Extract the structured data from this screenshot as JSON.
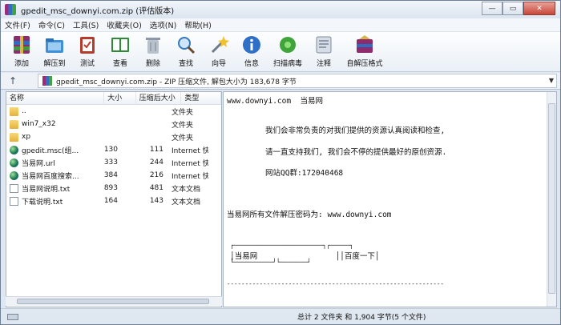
{
  "window": {
    "title": "gpedit_msc_downyi.com.zip (评估版本)"
  },
  "titlebar": {
    "minimize": "—",
    "maximize": "▭",
    "close": "✕"
  },
  "menu": [
    "文件(F)",
    "命令(C)",
    "工具(S)",
    "收藏夹(O)",
    "选项(N)",
    "帮助(H)"
  ],
  "toolbar": [
    {
      "label": "添加",
      "icon": "add-archive-icon"
    },
    {
      "label": "解压到",
      "icon": "extract-folder-icon"
    },
    {
      "label": "测试",
      "icon": "test-clipboard-icon"
    },
    {
      "label": "查看",
      "icon": "view-book-icon"
    },
    {
      "label": "删除",
      "icon": "trash-icon"
    },
    {
      "label": "查找",
      "icon": "magnifier-icon"
    },
    {
      "label": "向导",
      "icon": "wizard-wand-icon"
    },
    {
      "label": "信息",
      "icon": "info-icon"
    },
    {
      "label": "扫描病毒",
      "icon": "virus-scan-icon"
    },
    {
      "label": "注释",
      "icon": "comment-icon"
    },
    {
      "label": "自解压格式",
      "icon": "sfx-box-icon"
    }
  ],
  "address": {
    "up": "↑",
    "path": "gpedit_msc_downyi.com.zip - ZIP 压缩文件, 解包大小为 183,678 字节",
    "dropdown": "▼"
  },
  "columns": {
    "name": "名称",
    "size": "大小",
    "packed": "压缩后大小",
    "type": "类型"
  },
  "files": [
    {
      "name": "..",
      "size": "",
      "packed": "",
      "type": "文件夹",
      "icon": "folder"
    },
    {
      "name": "win7_x32",
      "size": "",
      "packed": "",
      "type": "文件夹",
      "icon": "folder"
    },
    {
      "name": "xp",
      "size": "",
      "packed": "",
      "type": "文件夹",
      "icon": "folder"
    },
    {
      "name": "gpedit.msc(组...",
      "size": "130",
      "packed": "111",
      "type": "Internet 快",
      "icon": "globe"
    },
    {
      "name": "当易网.url",
      "size": "333",
      "packed": "244",
      "type": "Internet 快",
      "icon": "globe"
    },
    {
      "name": "当易网百度搜索...",
      "size": "384",
      "packed": "216",
      "type": "Internet 快",
      "icon": "globe"
    },
    {
      "name": "当易网说明.txt",
      "size": "893",
      "packed": "481",
      "type": "文本文档",
      "icon": "txt"
    },
    {
      "name": "下载说明.txt",
      "size": "164",
      "packed": "143",
      "type": "文本文档",
      "icon": "txt"
    }
  ],
  "comment": {
    "line1": "www.downyi.com  当易网",
    "line2": "我们会非常负责的对我们提供的资源认真阅读和检查,",
    "line3": "请一直支持我们, 我们会不停的提供最好的原创资源.",
    "line4": "网站QQ群:172040468",
    "line5": "当易网所有文件解压密码为: www.downyi.com",
    "box1": "┌───────────────────────┐┌─────┐",
    "box2": "│当易网                 ││百度一下│",
    "box3": "└──────────┘└───────┘",
    "dashes": "------------------------------------------------------------"
  },
  "status": {
    "summary": "总计 2 文件夹 和 1,904 字节(5 个文件)"
  }
}
